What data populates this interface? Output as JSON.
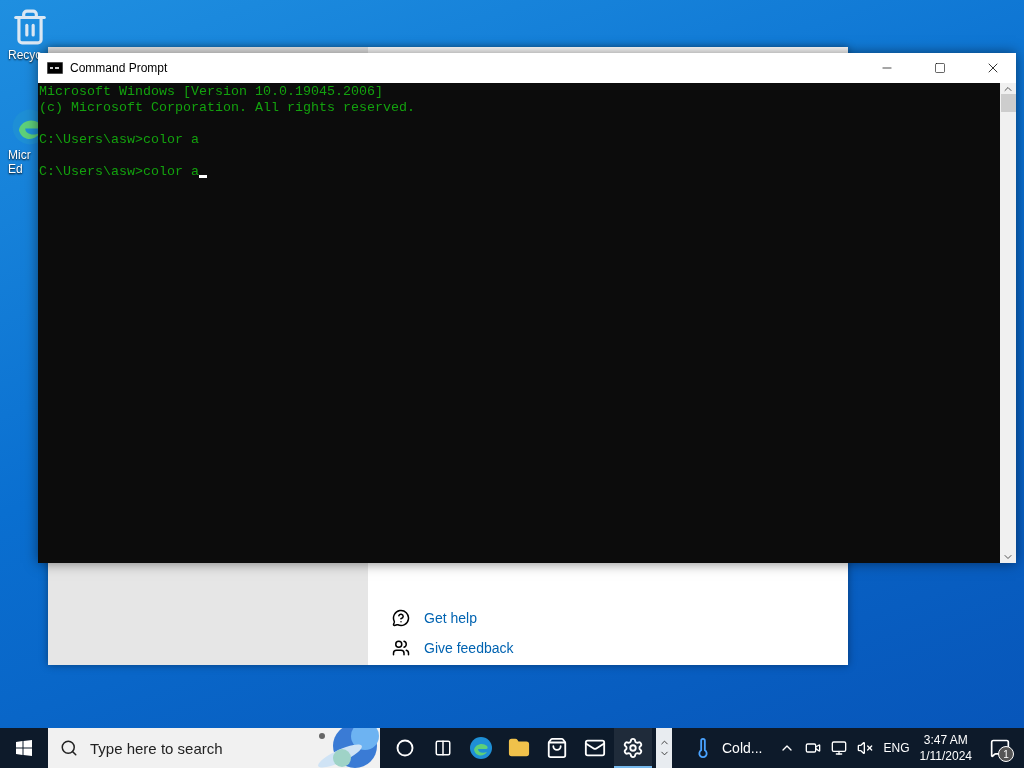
{
  "desktop_icons": [
    {
      "kind": "recycle",
      "label": "Recyc"
    },
    {
      "kind": "edge",
      "label": "Micr Ed"
    }
  ],
  "settings_window": {
    "links": [
      {
        "kind": "help",
        "label": "Get help"
      },
      {
        "kind": "feedback",
        "label": "Give feedback"
      }
    ]
  },
  "console_window": {
    "title": "Command Prompt",
    "paragraphs": [
      [
        "Microsoft Windows [Version 10.0.19045.2006]",
        "(c) Microsoft Corporation. All rights reserved."
      ],
      [
        "C:\\Users\\asw>color a"
      ],
      [
        "C:\\Users\\asw>color a"
      ]
    ]
  },
  "taskbar": {
    "search": {
      "placeholder": "Type here to search"
    },
    "apps": [
      {
        "kind": "cortana",
        "selected": false
      },
      {
        "kind": "taskview",
        "selected": false
      },
      {
        "kind": "edge",
        "selected": false
      },
      {
        "kind": "explorer",
        "selected": false
      },
      {
        "kind": "store",
        "selected": false
      },
      {
        "kind": "mail",
        "selected": false
      },
      {
        "kind": "settings",
        "selected": true
      }
    ],
    "weather": "Cold...",
    "language": "ENG",
    "time": "3:47 AM",
    "date": "1/11/2024",
    "notification_count": "1"
  }
}
